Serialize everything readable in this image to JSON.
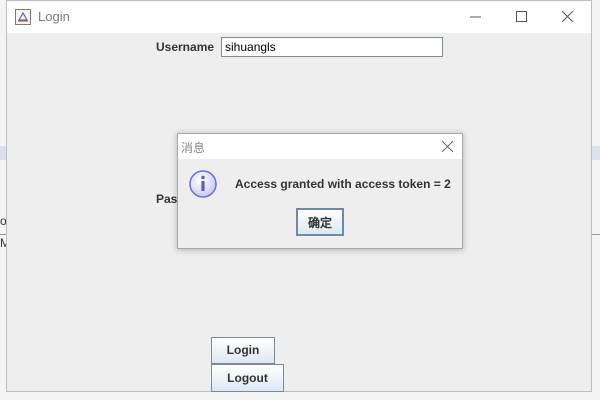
{
  "background": {
    "fragment_left_1": "ob",
    "fragment_left_2": "Ma"
  },
  "window": {
    "title": "Login",
    "username_label": "Username",
    "username_value": "sihuangls",
    "password_label_partial": "Pas",
    "login_button": "Login",
    "logout_button": "Logout"
  },
  "dialog": {
    "title": "消息",
    "message": "Access granted with access token = 2",
    "ok_button": "确定"
  },
  "colors": {
    "window_bg": "#eeeeee",
    "titlebar_bg": "#ffffff",
    "info_icon": "#6b6fd1",
    "button_border": "#7a8a99"
  }
}
